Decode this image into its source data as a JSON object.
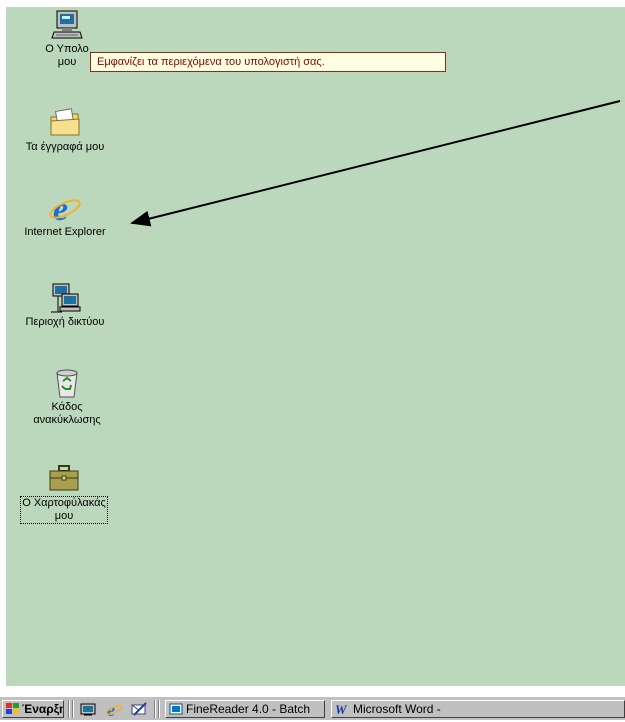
{
  "desktop": {
    "icons": [
      {
        "name": "my-computer-icon",
        "label_line1": "Ο Υπολο",
        "label_line2": "μου"
      },
      {
        "name": "my-documents-icon",
        "label": "Τα έγγραφά μου"
      },
      {
        "name": "internet-explorer-icon",
        "label": "Internet Explorer"
      },
      {
        "name": "network-places-icon",
        "label": "Περιοχή δικτύου"
      },
      {
        "name": "recycle-bin-icon",
        "label_line1": "Κάδος",
        "label_line2": "ανακύκλωσης"
      },
      {
        "name": "briefcase-icon",
        "label_line1": "Ο Χαρτοφύλακάς",
        "label_line2": "μου"
      }
    ],
    "tooltip": "Εμφανίζει τα περιεχόμενα του υπολογιστή σας."
  },
  "taskbar": {
    "start_label": "Έναρξη",
    "tasks": [
      {
        "label": "FineReader 4.0 - Batch",
        "icon": "finereader-icon"
      },
      {
        "label": "Microsoft Word -",
        "icon": "word-icon"
      }
    ],
    "quick_launch": [
      "show-desktop-icon",
      "internet-explorer-icon",
      "outlook-express-icon"
    ]
  },
  "colors": {
    "desktop": "#bcd8bc",
    "taskbar": "#c0c0c0",
    "tooltip_bg": "#ffffe1",
    "tooltip_text": "#8b0000"
  }
}
